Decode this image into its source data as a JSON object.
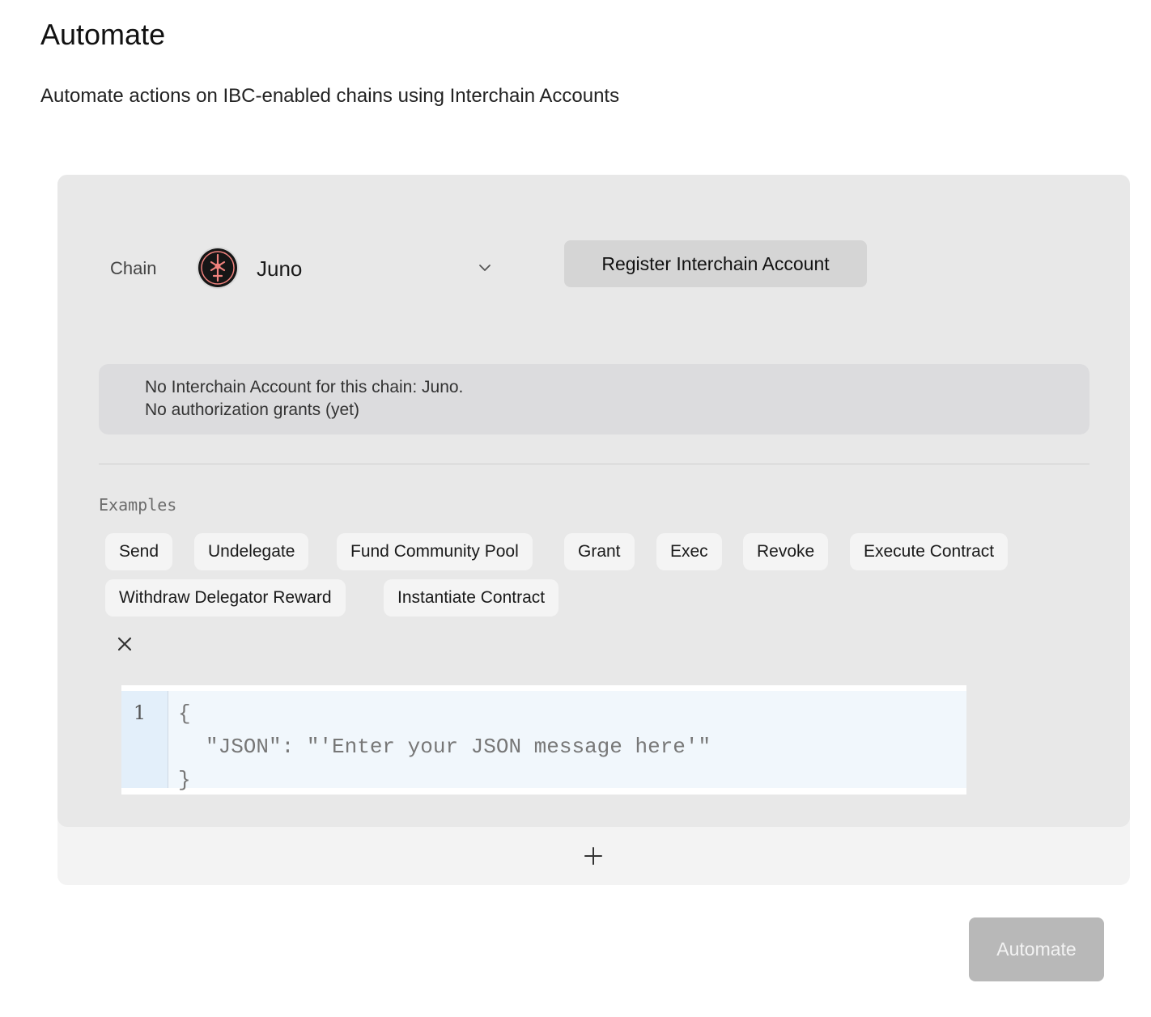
{
  "page": {
    "title": "Automate",
    "subtitle": "Automate actions on IBC-enabled chains using Interchain Accounts"
  },
  "chain": {
    "label": "Chain",
    "selected": "Juno",
    "logo_icon": "juno-logo-icon",
    "logo_color": "#f0827d"
  },
  "register_button": "Register Interchain Account",
  "status": {
    "line1": "No Interchain Account for this chain: Juno.",
    "line2": "No authorization grants (yet)"
  },
  "examples": {
    "label": "Examples",
    "items": [
      "Send",
      "Undelegate",
      "Fund Community Pool",
      "Grant",
      "Exec",
      "Revoke",
      "Execute Contract",
      "Withdraw Delegator Reward",
      "Instantiate Contract"
    ]
  },
  "editor": {
    "line_number": "1",
    "lines": [
      "{",
      "\"JSON\": \"'Enter your JSON message here'\"",
      "}"
    ]
  },
  "automate_button": "Automate"
}
